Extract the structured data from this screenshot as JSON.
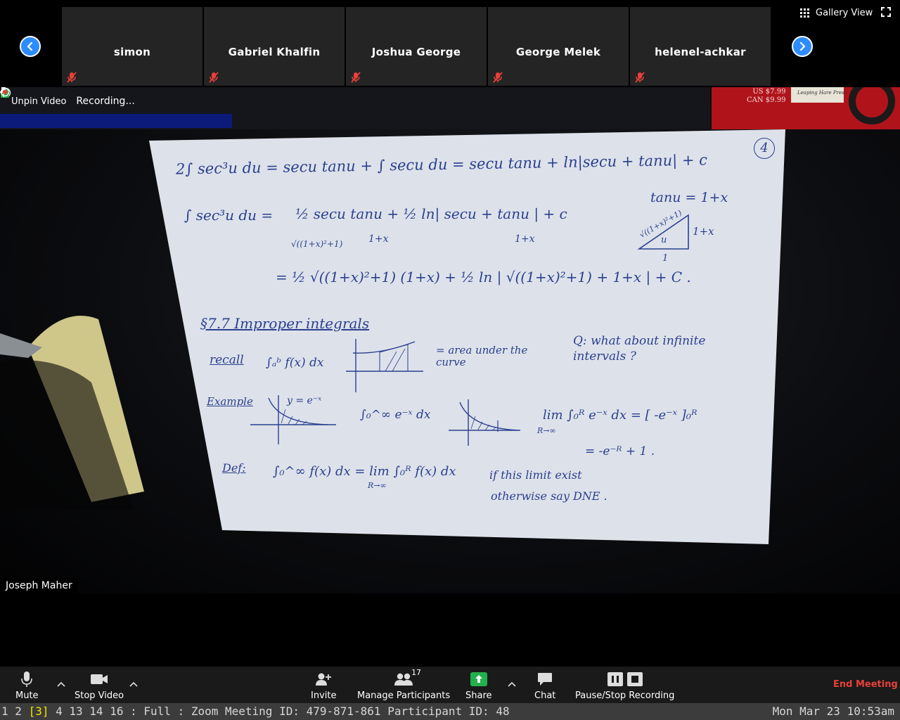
{
  "strip": {
    "participants": [
      {
        "name": "simon"
      },
      {
        "name": "Gabriel Khalfin"
      },
      {
        "name": "Joshua George"
      },
      {
        "name": "George Melek"
      },
      {
        "name": "helenel-achkar"
      }
    ],
    "gallery_view_label": "Gallery View"
  },
  "video": {
    "overlay": {
      "unpin_label": "Unpin Video",
      "recording_label": "Recording..."
    },
    "speaker_name": "Joseph Maher",
    "book_price": [
      "US $7.99",
      "CAN $9.99"
    ],
    "book_title": "Leaping Hare Press",
    "whiteboard": {
      "page_number": "4",
      "lines": {
        "l1": "2∫ sec³u du =  secu tanu  +  ∫ secu du  =  secu tanu  +  ln|secu + tanu| + c",
        "l2_lhs": "∫ sec³u du =",
        "l2_rhs": "½ secu tanu  +  ½ ln| secu + tanu | + c",
        "l2_sub1": "√((1+x)²+1)",
        "l2_sub2": "1+x",
        "l2_sub3": "1+x",
        "tri_eq": "tanu = 1+x",
        "tri_hyp": "√((1+x)²+1)",
        "tri_opp": "1+x",
        "tri_adj": "1",
        "tri_angle": "u",
        "l3": "=  ½ √((1+x)²+1) (1+x)  +  ½ ln | √((1+x)²+1)  +  1+x |  +  C .",
        "section": "§7.7 Improper integrals",
        "recall": "recall",
        "recall_int": "∫ₐᵇ f(x) dx",
        "area_text": "= area under the curve",
        "question": "Q: what about infinite intervals ?",
        "example": "Example",
        "ex_curve": "y = e⁻ˣ",
        "ex_int": "∫₀^∞ e⁻ˣ dx",
        "ex_limit": "lim  ∫₀ᴿ e⁻ˣ dx  =  [ -e⁻ˣ ]₀ᴿ",
        "ex_limit_sub": "R→∞",
        "ex_result": "=   -e⁻ᴿ + 1 .",
        "def": "Def:",
        "def_eq": "∫₀^∞ f(x) dx  =  lim  ∫₀ᴿ f(x) dx",
        "def_sub": "R→∞",
        "def_tail1": "if this limit exist",
        "def_tail2": "otherwise say DNE ."
      }
    }
  },
  "toolbar": {
    "mute_label": "Mute",
    "stop_video_label": "Stop Video",
    "invite_label": "Invite",
    "manage_participants_label": "Manage Participants",
    "participant_count": "17",
    "share_label": "Share",
    "chat_label": "Chat",
    "pause_stop_label": "Pause/Stop Recording",
    "end_meeting_label": "End Meeting"
  },
  "statusbar": {
    "workspaces": [
      {
        "label": "1",
        "active": false
      },
      {
        "label": "2",
        "active": false
      },
      {
        "label": "[3]",
        "active": true
      },
      {
        "label": "4",
        "active": false
      },
      {
        "label": "13",
        "active": false
      },
      {
        "label": "14",
        "active": false
      },
      {
        "label": "16",
        "active": false
      }
    ],
    "separator": ":",
    "mode": "Full",
    "window_title": "Zoom Meeting ID: 479-871-861 Participant ID: 48",
    "clock": "Mon Mar 23 10:53am"
  },
  "colors": {
    "accent_blue": "#2d8cff",
    "end_meeting_red": "#e8403a",
    "share_green": "#23b14d",
    "active_workspace_yellow": "#f2e600",
    "ink_blue": "#2b3f8f"
  }
}
